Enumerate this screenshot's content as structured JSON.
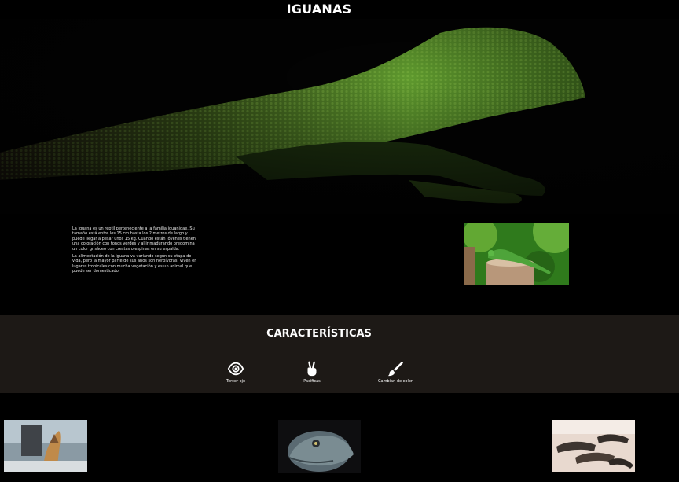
{
  "header": {
    "title": "IGUANAS"
  },
  "hero": {
    "image": "bearded-dragon-photo"
  },
  "intro": {
    "paragraphs": [
      "La iguana es un reptil perteneciente a la familia iguanidae. Su tamaño está entre los 15 cm hasta los 2 metros de largo y puede llegar a pesar unos 15 kg. Cuando están jóvenes tienen una coloración con tonos verdes y al ir madurando predomina un color grisáceo con crestas o espinas en su espalda.",
      "La alimentación de la iguana va variando según su etapa de vida, pero la mayor parte de sus años son herbívoras. Viven en lugares tropicales con mucha vegetación y es un animal que puede ser domesticado."
    ],
    "photo": "green-iguana-on-stump-photo"
  },
  "features": {
    "title": "CARACTERÍSTICAS",
    "items": [
      {
        "label": "Tercer ojo",
        "icon": "eye-icon"
      },
      {
        "label": "Pacificas",
        "icon": "peace-hand-icon"
      },
      {
        "label": "Cambian de color",
        "icon": "paintbrush-icon"
      }
    ]
  },
  "gallery": {
    "images": [
      "iguana-on-rock-photo",
      "iguana-head-photo",
      "marine-iguanas-group-photo"
    ]
  },
  "colors": {
    "page_bg": "#000000",
    "features_bg": "#1d1916",
    "accent_green": "#4f8a2a"
  }
}
